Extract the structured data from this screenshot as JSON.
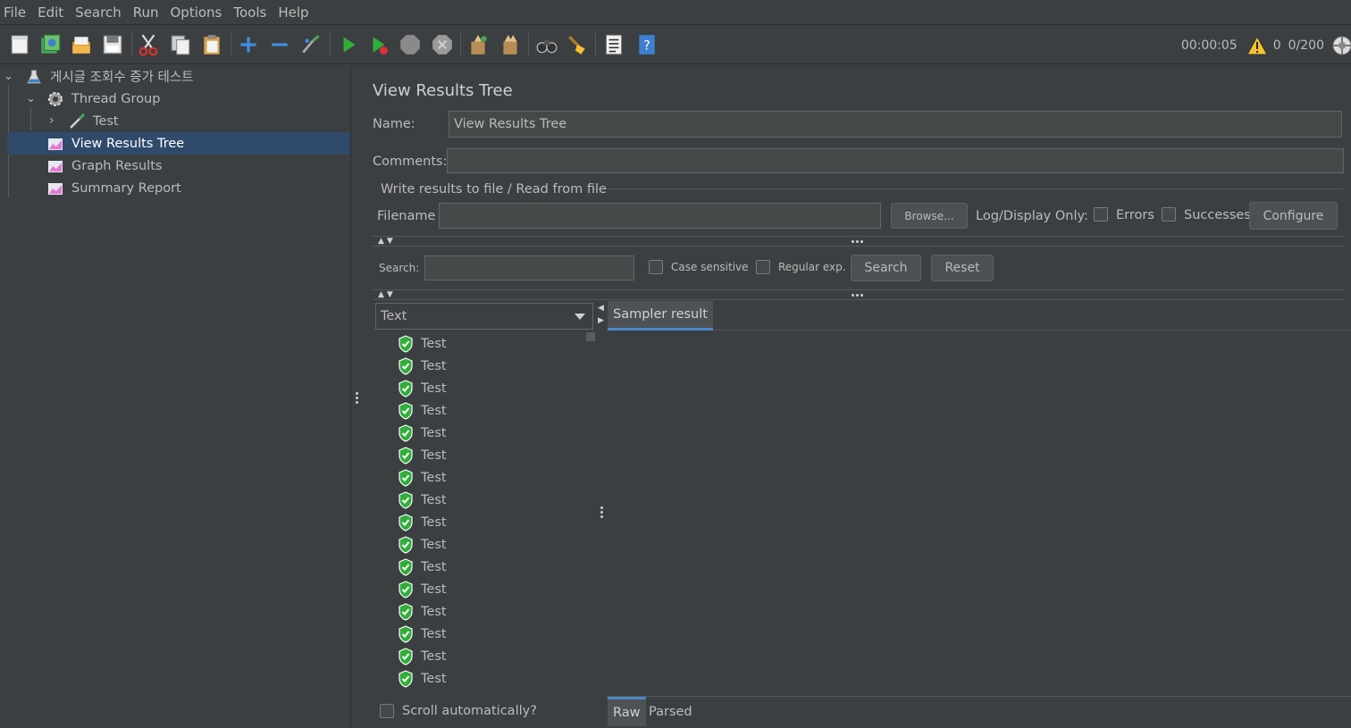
{
  "menu": [
    "File",
    "Edit",
    "Search",
    "Run",
    "Options",
    "Tools",
    "Help"
  ],
  "toolbar": {
    "icons": [
      "new-icon",
      "templates-icon",
      "open-icon",
      "save-icon",
      "cut-icon",
      "copy-icon",
      "paste-icon",
      "expand-icon",
      "collapse-icon",
      "toggle-icon",
      "start-icon",
      "start-no-pauses-icon",
      "stop-icon",
      "shutdown-icon",
      "clear-icon",
      "clear-all-icon",
      "search-icon",
      "reset-search-icon",
      "function-helper-icon",
      "help-icon"
    ]
  },
  "status": {
    "timer": "00:00:05",
    "warnings": "0",
    "threads": "0/200"
  },
  "tree": {
    "root": "게시글 조회수 증가 테스트",
    "thread_group": "Thread Group",
    "sampler": "Test",
    "listeners": [
      "View Results Tree",
      "Graph Results",
      "Summary Report"
    ]
  },
  "panel": {
    "title": "View Results Tree",
    "name_label": "Name:",
    "name_value": "View Results Tree",
    "comments_label": "Comments:",
    "comments_value": "",
    "file_section": "Write results to file / Read from file",
    "filename_label": "Filename",
    "filename_value": "",
    "browse": "Browse...",
    "log_display": "Log/Display Only:",
    "errors": "Errors",
    "successes": "Successes",
    "configure": "Configure",
    "search_label": "Search:",
    "search_value": "",
    "case_sensitive": "Case sensitive",
    "regular_exp": "Regular exp.",
    "search_button": "Search",
    "reset_button": "Reset",
    "renderer": "Text",
    "results": [
      "Test",
      "Test",
      "Test",
      "Test",
      "Test",
      "Test",
      "Test",
      "Test",
      "Test",
      "Test",
      "Test",
      "Test",
      "Test",
      "Test",
      "Test",
      "Test"
    ],
    "scroll_auto": "Scroll automatically?",
    "tab_sampler": "Sampler result",
    "tab_raw": "Raw",
    "tab_parsed": "Parsed"
  },
  "colors": {
    "background": "#3c3f41",
    "selection": "#2f4a6b",
    "accent": "#4a88c7",
    "success": "#2fae3a"
  }
}
